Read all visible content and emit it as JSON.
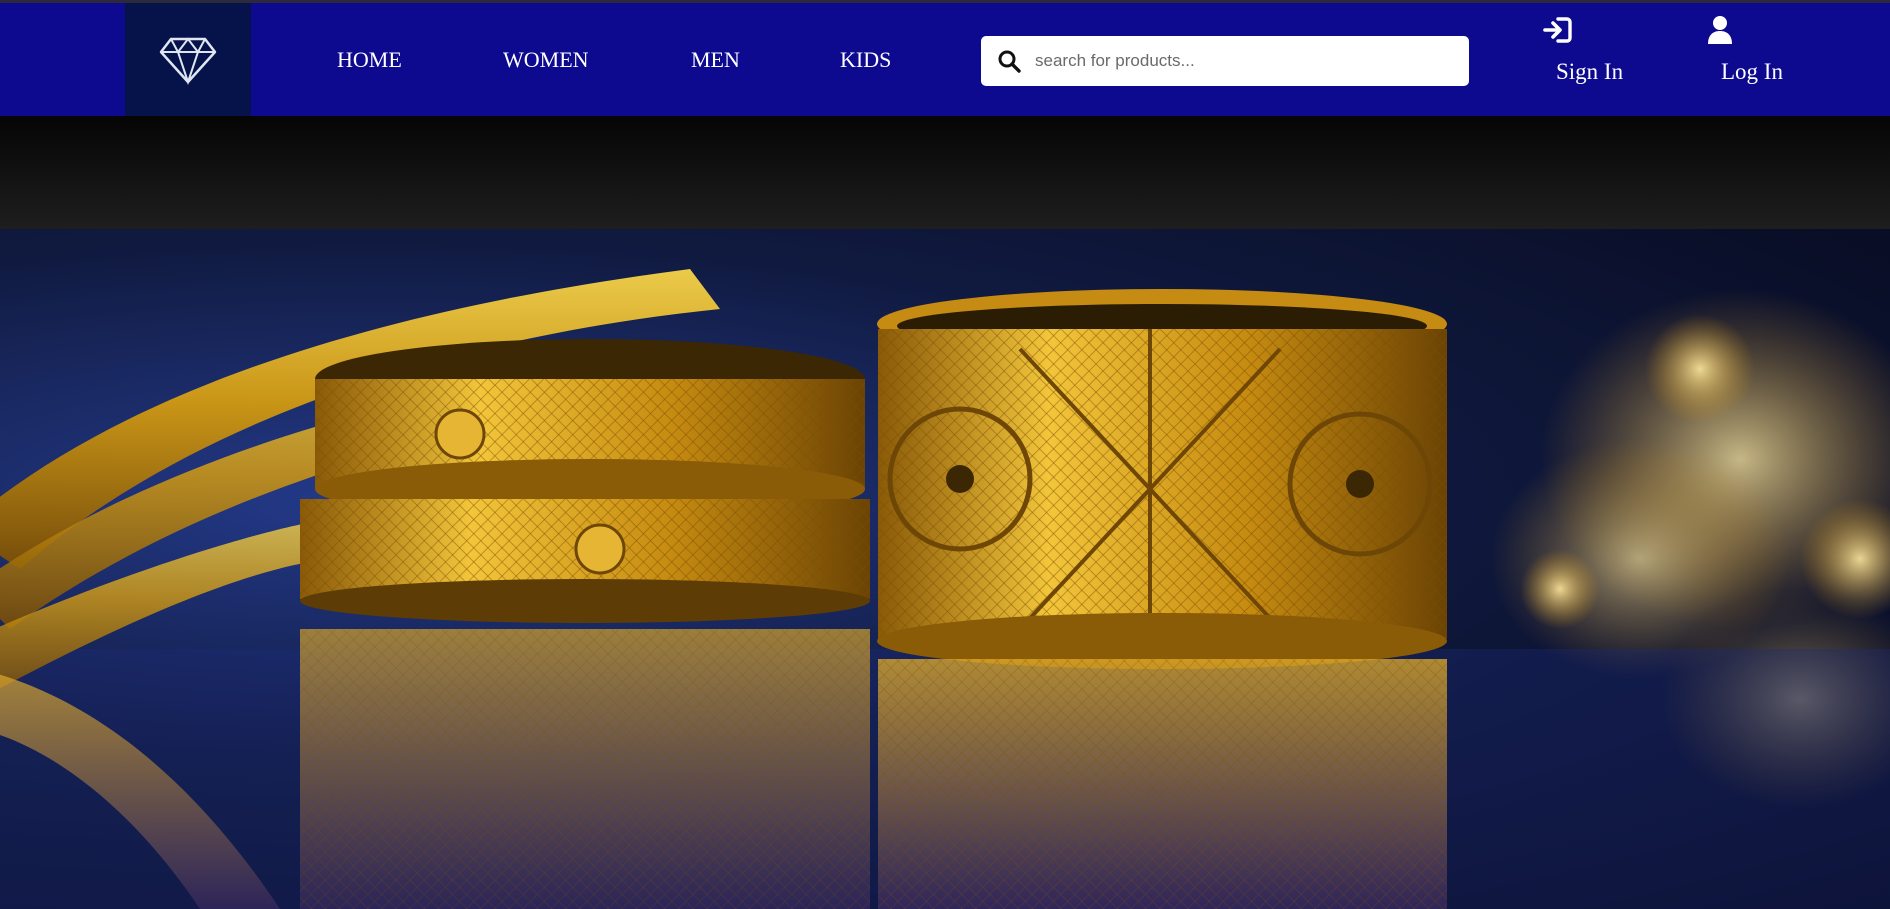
{
  "nav": {
    "links": [
      "HOME",
      "WOMEN",
      "MEN",
      "KIDS"
    ],
    "search": {
      "placeholder": "search for products..."
    },
    "auth": {
      "sign_in": "Sign In",
      "log_in": "Log In"
    }
  },
  "icons": {
    "logo": "diamond-icon",
    "search": "search-icon",
    "sign_in": "sign-in-arrow-icon",
    "log_in": "user-icon"
  },
  "colors": {
    "navbar": "#0d0a8f",
    "logo_box": "#06124a",
    "gold": "#d4a017"
  }
}
